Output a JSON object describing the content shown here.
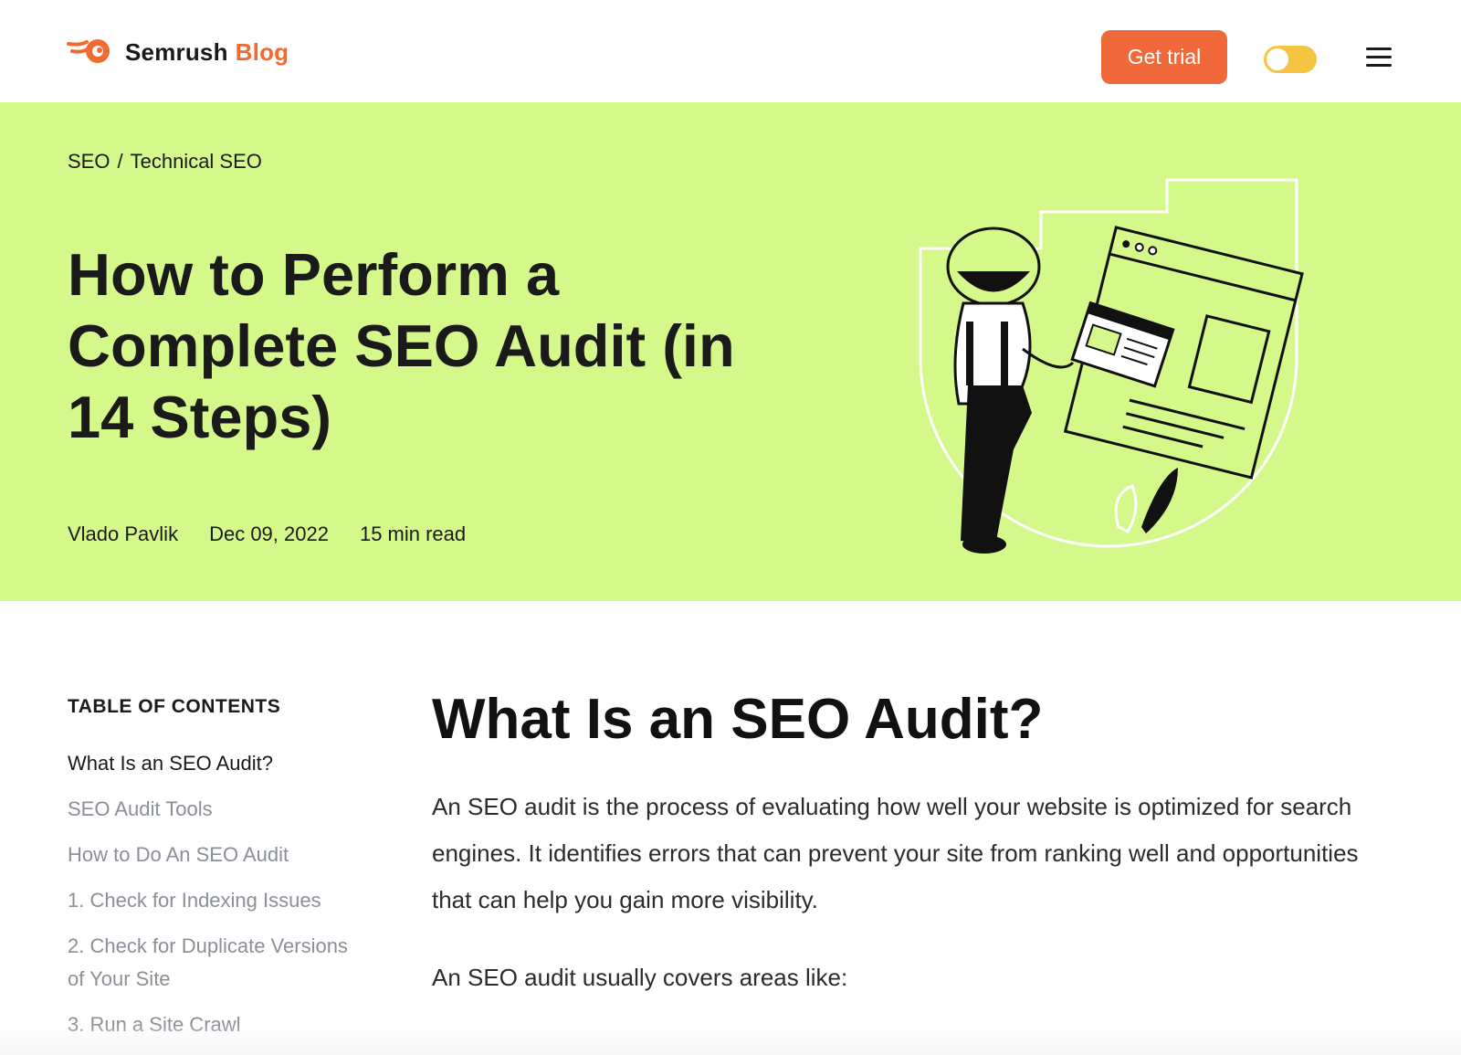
{
  "header": {
    "logo_text": "Semrush",
    "logo_accent": "Blog",
    "trial_label": "Get trial",
    "theme_toggle_icon": "toggle-switch",
    "menu_icon": "hamburger-icon"
  },
  "hero": {
    "breadcrumb": [
      "SEO",
      "Technical SEO"
    ],
    "breadcrumb_sep": "/",
    "title": "How to Perform a Complete SEO Audit (in 14 Steps)",
    "author": "Vlado Pavlik",
    "date": "Dec 09, 2022",
    "read_time": "15 min read"
  },
  "toc": {
    "title": "TABLE OF CONTENTS",
    "items": [
      "What Is an SEO Audit?",
      "SEO Audit Tools",
      "How to Do An SEO Audit",
      "1. Check for Indexing Issues",
      "2. Check for Duplicate Versions of Your Site",
      "3. Run a Site Crawl"
    ]
  },
  "article": {
    "heading": "What Is an SEO Audit?",
    "paragraphs": [
      "An SEO audit is the process of evaluating how well your website is optimized for search engines. It identifies errors that can prevent your site from ranking well and opportunities that can help you gain more visibility.",
      "An SEO audit usually covers areas like:"
    ]
  },
  "colors": {
    "brand_orange": "#f0693a",
    "hero_bg": "#d4f98a",
    "toggle": "#f5c542",
    "toc_muted": "#8a8f98"
  }
}
